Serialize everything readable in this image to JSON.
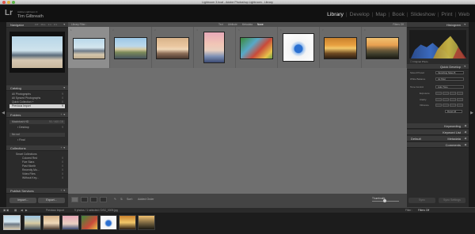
{
  "window": {
    "title": "Lightroom 3.lrcat - Adobe Photoshop Lightroom - Library"
  },
  "identity": {
    "logo": "Lr",
    "subtitle": "Adobe Lightroom 3",
    "name": "Tim Gilbreath"
  },
  "modules": [
    "Library",
    "Develop",
    "Map",
    "Book",
    "Slideshow",
    "Print",
    "Web"
  ],
  "active_module": "Library",
  "left_panel": {
    "navigator": {
      "title": "Navigator",
      "zoom_opts": [
        "FIT",
        "FILL",
        "1:1",
        "3:1"
      ]
    },
    "catalog": {
      "title": "Catalog",
      "items": [
        {
          "label": "All Photographs",
          "count": "9"
        },
        {
          "label": "All Synced Photographs",
          "count": "0"
        },
        {
          "label": "Quick Collection +",
          "count": "0"
        },
        {
          "label": "Previous Import",
          "count": "9"
        }
      ]
    },
    "folders": {
      "title": "Folders",
      "volumes": [
        {
          "label": "Macintosh HD",
          "size": "90 / 465 GB"
        },
        {
          "label": "Desktop",
          "count": "9"
        },
        {
          "label": "No vol",
          "size": ""
        },
        {
          "label": "Final",
          "count": ""
        }
      ]
    },
    "collections": {
      "title": "Collections",
      "items": [
        {
          "label": "Smart Collections",
          "count": ""
        },
        {
          "label": "Colored Red",
          "count": "0"
        },
        {
          "label": "Five Stars",
          "count": "0"
        },
        {
          "label": "Past Month",
          "count": "0"
        },
        {
          "label": "Recently Mo...",
          "count": "0"
        },
        {
          "label": "Video Files",
          "count": "0"
        },
        {
          "label": "Without Key...",
          "count": "0"
        }
      ]
    },
    "publish": {
      "title": "Publish Services"
    },
    "import_btn": "Import...",
    "export_btn": "Export..."
  },
  "filter_bar": {
    "label": "Library Filter :",
    "tabs": [
      "Text",
      "Attribute",
      "Metadata",
      "None"
    ],
    "active_tab": "None",
    "preset": "Filters Off"
  },
  "grid": {
    "cells": [
      {
        "num": "1",
        "selected": true
      },
      {
        "num": "2",
        "selected": false
      },
      {
        "num": "3",
        "selected": false
      },
      {
        "num": "4",
        "selected": false
      },
      {
        "num": "5",
        "selected": false
      },
      {
        "num": "6",
        "selected": false
      },
      {
        "num": "7",
        "selected": false
      },
      {
        "num": "8",
        "selected": false
      }
    ]
  },
  "toolbar": {
    "sort_label": "Sort:",
    "sort_value": "Added Order",
    "thumbnails_label": "Thumbnails"
  },
  "right_panel": {
    "histogram": {
      "title": "Histogram",
      "original_photo": "Original Photo"
    },
    "quick_develop": {
      "title": "Quick Develop",
      "saved_preset_label": "Saved Preset",
      "saved_preset_value": "Vanishing Skies B",
      "wb_label": "White Balance",
      "wb_value": "As Shot",
      "tone_label": "Tone Control",
      "tone_btn": "Auto Tone",
      "exposure": "Exposure",
      "clarity": "Clarity",
      "vibrance": "Vibrance",
      "reset": "Reset All"
    },
    "keywording": "Keywording",
    "keyword_list": "Keyword List",
    "metadata": {
      "title": "Metadata",
      "preset": "Default"
    },
    "comments": "Comments",
    "sync_btn": "Sync",
    "sync_settings_btn": "Sync Settings"
  },
  "filmstrip": {
    "source": "Previous Import",
    "info": "9 photos / 1 selected / DSC_0009.jpg",
    "filter_label": "Filter :",
    "filter_value": "Filters Off"
  },
  "colors": {
    "panel": "#2b2b2b",
    "grid": "#6f6f6f",
    "selected": "#8e8e8e"
  }
}
